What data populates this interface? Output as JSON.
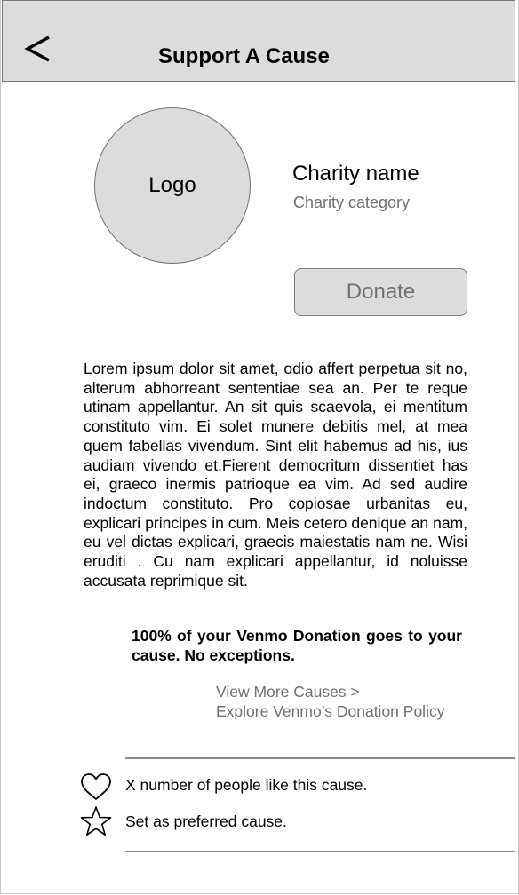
{
  "header": {
    "back_label": "<",
    "title": "Support A Cause"
  },
  "charity": {
    "logo_label": "Logo",
    "name": "Charity name",
    "category": "Charity category",
    "donate_label": "Donate"
  },
  "description": "Lorem ipsum dolor sit amet, odio affert perpetua sit no, alterum abhorreant sententiae sea an. Per te reque utinam appellantur. An sit quis scaevola, ei mentitum constituto vim. Ei solet munere debitis mel, at mea quem fabellas vivendum. Sint elit habemus ad his, ius audiam vivendo et.Fierent democritum dissentiet has ei, graeco inermis patrioque ea vim. Ad sed audire indoctum constituto. Pro copiosae urbanitas eu, explicari principes in cum. Meis cetero denique an nam, eu vel dictas explicari, graecis maiestatis nam ne. Wisi eruditi . Cu nam explicari appellantur, id noluisse accusata reprimique sit.",
  "guarantee": "100% of your Venmo Donation goes to your cause. No exceptions.",
  "links": {
    "view_more": "View More Causes  >",
    "policy": "Explore Venmo’s Donation Policy"
  },
  "actions": {
    "like_text": "X number of people like this cause.",
    "like_icon": "heart-icon",
    "preferred_text": "Set as preferred cause.",
    "preferred_icon": "star-icon"
  },
  "colors": {
    "header_bg": "#dcdcdc",
    "muted_text": "#707070",
    "border": "#7a7a7a"
  }
}
